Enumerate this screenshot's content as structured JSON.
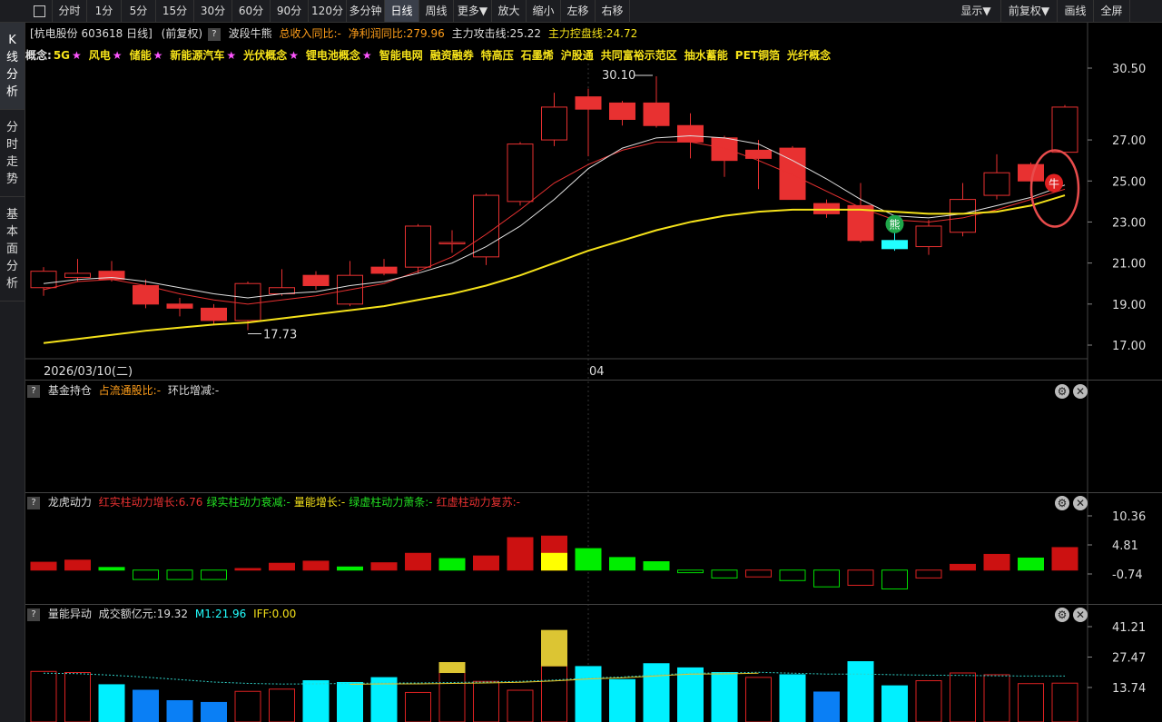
{
  "toolbar": {
    "left": [
      "分时",
      "1分",
      "5分",
      "15分",
      "30分",
      "60分",
      "90分",
      "120分",
      "多分钟",
      "日线",
      "周线",
      "更多▼",
      "放大",
      "缩小",
      "左移",
      "右移"
    ],
    "active": "日线",
    "right": [
      "显示▼",
      "前复权▼",
      "画线",
      "全屏"
    ]
  },
  "sidebar": [
    {
      "label": "K线分析",
      "active": true
    },
    {
      "label": "分时走势",
      "active": false
    },
    {
      "label": "基本面分析",
      "active": false
    }
  ],
  "header": {
    "stock": "[杭电股份 603618 日线]",
    "fq": "(前复权)",
    "indicator": "波段牛熊",
    "revenue_yoy": "总收入同比:-",
    "profit_yoy": "净利润同比:279.96",
    "attack": "主力攻击线:25.22",
    "control": "主力控盘线:24.72"
  },
  "concepts": {
    "label": "概念:",
    "items": [
      {
        "text": "5G",
        "star": true
      },
      {
        "text": "风电",
        "star": true
      },
      {
        "text": "储能",
        "star": true
      },
      {
        "text": "新能源汽车",
        "star": true
      },
      {
        "text": "光伏概念",
        "star": true
      },
      {
        "text": "锂电池概念",
        "star": true
      },
      {
        "text": "智能电网",
        "star": false
      },
      {
        "text": "融资融券",
        "star": false
      },
      {
        "text": "特高压",
        "star": false
      },
      {
        "text": "石墨烯",
        "star": false
      },
      {
        "text": "沪股通",
        "star": false
      },
      {
        "text": "共同富裕示范区",
        "star": false
      },
      {
        "text": "抽水蓄能",
        "star": false
      },
      {
        "text": "PET铜箔",
        "star": false
      },
      {
        "text": "光纤概念",
        "star": false
      }
    ]
  },
  "main_chart": {
    "y_ticks": [
      "30.50",
      "27.00",
      "25.00",
      "23.00",
      "21.00",
      "19.00",
      "17.00"
    ],
    "date_label": "2026/03/10(二)",
    "month_label": "04",
    "high_label": "30.10",
    "low_label": "17.73",
    "bear_badge": "熊",
    "bull_badge": "牛"
  },
  "fund_panel": {
    "title": "基金持仓",
    "ratio": "占流通股比:-",
    "change": "环比增减:-"
  },
  "dragon_panel": {
    "title": "龙虎动力",
    "items": [
      {
        "text": "红实柱动力增长:6.76",
        "color": "#e83131"
      },
      {
        "text": "绿实柱动力衰减:-",
        "color": "#22dd22"
      },
      {
        "text": "量能增长:-",
        "color": "#f5e21a"
      },
      {
        "text": "绿虚柱动力萧条:-",
        "color": "#22dd22"
      },
      {
        "text": "红虚柱动力复苏:-",
        "color": "#e83131"
      }
    ],
    "y_ticks": [
      "10.36",
      "4.81",
      "-0.74"
    ]
  },
  "volume_panel": {
    "title": "量能异动",
    "amount": "成交额亿元:19.32",
    "m1": "M1:21.96",
    "iff": "IFF:0.00",
    "y_ticks": [
      "41.21",
      "27.47",
      "13.74"
    ]
  },
  "colors": {
    "up": "#e83131",
    "down": "#22ffff",
    "ma_yellow": "#f5e21a",
    "ma_white": "#e0e0e0",
    "ma_red": "#e83131"
  },
  "chart_data": [
    {
      "type": "candlestick",
      "title": "杭电股份 603618 日线",
      "ylim": [
        17.0,
        30.5
      ],
      "candles": [
        {
          "o": 19.8,
          "c": 20.6,
          "h": 20.8,
          "l": 19.4
        },
        {
          "o": 20.3,
          "c": 20.5,
          "h": 21.2,
          "l": 20.1
        },
        {
          "o": 20.6,
          "c": 20.2,
          "h": 21.1,
          "l": 20.1
        },
        {
          "o": 19.9,
          "c": 19.0,
          "h": 20.2,
          "l": 18.8
        },
        {
          "o": 19.0,
          "c": 18.8,
          "h": 19.3,
          "l": 18.4
        },
        {
          "o": 18.8,
          "c": 18.2,
          "h": 19.0,
          "l": 18.0
        },
        {
          "o": 18.2,
          "c": 20.0,
          "h": 20.1,
          "l": 17.73
        },
        {
          "o": 19.5,
          "c": 19.8,
          "h": 20.7,
          "l": 19.4
        },
        {
          "o": 20.4,
          "c": 19.9,
          "h": 20.6,
          "l": 19.7
        },
        {
          "o": 19.0,
          "c": 20.4,
          "h": 21.1,
          "l": 18.9
        },
        {
          "o": 20.8,
          "c": 20.5,
          "h": 21.2,
          "l": 20.4
        },
        {
          "o": 20.8,
          "c": 22.8,
          "h": 22.9,
          "l": 20.5
        },
        {
          "o": 22.0,
          "c": 22.0,
          "h": 22.6,
          "l": 21.5
        },
        {
          "o": 21.3,
          "c": 24.3,
          "h": 24.4,
          "l": 20.9
        },
        {
          "o": 24.0,
          "c": 26.8,
          "h": 26.9,
          "l": 23.8
        },
        {
          "o": 27.0,
          "c": 28.6,
          "h": 29.3,
          "l": 26.7
        },
        {
          "o": 29.1,
          "c": 28.5,
          "h": 29.5,
          "l": 26.2
        },
        {
          "o": 28.8,
          "c": 28.0,
          "h": 28.9,
          "l": 27.7
        },
        {
          "o": 28.8,
          "c": 27.7,
          "h": 30.1,
          "l": 27.6
        },
        {
          "o": 27.7,
          "c": 26.9,
          "h": 28.3,
          "l": 26.1
        },
        {
          "o": 27.1,
          "c": 26.0,
          "h": 27.2,
          "l": 25.2
        },
        {
          "o": 26.5,
          "c": 26.1,
          "h": 27.0,
          "l": 24.6
        },
        {
          "o": 26.6,
          "c": 24.1,
          "h": 26.7,
          "l": 24.1
        },
        {
          "o": 23.9,
          "c": 23.4,
          "h": 24.1,
          "l": 23.2
        },
        {
          "o": 23.8,
          "c": 22.1,
          "h": 24.9,
          "l": 22.0
        },
        {
          "o": 22.1,
          "c": 21.7,
          "h": 22.6,
          "l": 21.6
        },
        {
          "o": 21.8,
          "c": 22.8,
          "h": 23.1,
          "l": 21.4
        },
        {
          "o": 22.5,
          "c": 24.1,
          "h": 24.9,
          "l": 22.3
        },
        {
          "o": 24.3,
          "c": 25.4,
          "h": 26.3,
          "l": 24.1
        },
        {
          "o": 25.8,
          "c": 25.0,
          "h": 25.9,
          "l": 24.3
        },
        {
          "o": 26.4,
          "c": 28.6,
          "h": 28.7,
          "l": 26.3
        }
      ],
      "ma_yellow": [
        17.1,
        17.3,
        17.5,
        17.7,
        17.85,
        18.0,
        18.1,
        18.3,
        18.5,
        18.7,
        18.9,
        19.2,
        19.5,
        19.9,
        20.4,
        21.0,
        21.6,
        22.1,
        22.6,
        23.0,
        23.3,
        23.5,
        23.6,
        23.6,
        23.6,
        23.5,
        23.4,
        23.4,
        23.5,
        23.8,
        24.3
      ],
      "ma_white": [
        20.0,
        20.2,
        20.3,
        20.1,
        19.8,
        19.5,
        19.3,
        19.5,
        19.6,
        19.9,
        20.1,
        20.5,
        21.0,
        21.8,
        22.8,
        24.1,
        25.6,
        26.6,
        27.1,
        27.2,
        27.1,
        26.8,
        26.0,
        25.1,
        24.1,
        23.3,
        23.2,
        23.4,
        23.8,
        24.2,
        24.8
      ],
      "ma_red": [
        19.7,
        20.1,
        20.2,
        19.9,
        19.5,
        19.2,
        19.0,
        19.2,
        19.4,
        19.7,
        20.0,
        20.6,
        21.3,
        22.4,
        23.6,
        24.9,
        25.8,
        26.5,
        26.9,
        26.9,
        26.6,
        26.0,
        25.3,
        24.5,
        23.7,
        23.1,
        23.0,
        23.2,
        23.6,
        24.1,
        24.6
      ]
    },
    {
      "type": "bar",
      "title": "龙虎动力",
      "ylim": [
        -4.0,
        11.5
      ],
      "values": [
        {
          "v": 1.5,
          "k": "red_solid"
        },
        {
          "v": 1.9,
          "k": "red_solid"
        },
        {
          "v": 0.5,
          "k": "green_solid"
        },
        {
          "v": -1.8,
          "k": "green_hollow"
        },
        {
          "v": -1.8,
          "k": "green_hollow"
        },
        {
          "v": -1.8,
          "k": "green_hollow"
        },
        {
          "v": 0.3,
          "k": "red_solid"
        },
        {
          "v": 1.3,
          "k": "red_solid"
        },
        {
          "v": 1.7,
          "k": "red_solid"
        },
        {
          "v": 0.6,
          "k": "green_solid"
        },
        {
          "v": 1.4,
          "k": "red_solid"
        },
        {
          "v": 3.2,
          "k": "red_solid"
        },
        {
          "v": 2.2,
          "k": "green_solid"
        },
        {
          "v": 2.7,
          "k": "red_solid"
        },
        {
          "v": 6.2,
          "k": "red_solid"
        },
        {
          "v": 6.5,
          "k": "red_yellow",
          "y": 3.2
        },
        {
          "v": 4.1,
          "k": "green_solid"
        },
        {
          "v": 2.4,
          "k": "green_solid"
        },
        {
          "v": 1.6,
          "k": "green_solid"
        },
        {
          "v": -0.5,
          "k": "green_hollow"
        },
        {
          "v": -1.5,
          "k": "green_hollow"
        },
        {
          "v": -1.3,
          "k": "red_hollow"
        },
        {
          "v": -2.0,
          "k": "green_hollow"
        },
        {
          "v": -3.2,
          "k": "green_hollow"
        },
        {
          "v": -2.9,
          "k": "red_hollow"
        },
        {
          "v": -3.6,
          "k": "green_hollow"
        },
        {
          "v": -1.5,
          "k": "red_hollow"
        },
        {
          "v": 1.1,
          "k": "red_solid"
        },
        {
          "v": 3.0,
          "k": "red_solid"
        },
        {
          "v": 2.3,
          "k": "green_solid"
        },
        {
          "v": 4.3,
          "k": "red_solid"
        }
      ]
    },
    {
      "type": "bar",
      "title": "量能异动",
      "ylim": [
        0,
        43
      ],
      "values": [
        {
          "v": 21.0,
          "k": "red_hollow"
        },
        {
          "v": 20.5,
          "k": "red_hollow"
        },
        {
          "v": 15.0,
          "k": "cyan"
        },
        {
          "v": 12.5,
          "k": "blue"
        },
        {
          "v": 7.8,
          "k": "blue"
        },
        {
          "v": 7.0,
          "k": "blue"
        },
        {
          "v": 12.0,
          "k": "red_hollow"
        },
        {
          "v": 13.0,
          "k": "red_hollow"
        },
        {
          "v": 16.8,
          "k": "cyan"
        },
        {
          "v": 16.0,
          "k": "cyan"
        },
        {
          "v": 18.2,
          "k": "cyan"
        },
        {
          "v": 11.5,
          "k": "red_hollow"
        },
        {
          "v": 20.5,
          "k": "red_hollow",
          "y": 4.5
        },
        {
          "v": 16.5,
          "k": "red_hollow"
        },
        {
          "v": 12.5,
          "k": "red_hollow"
        },
        {
          "v": 23.5,
          "k": "red_hollow",
          "y": 16.0
        },
        {
          "v": 23.2,
          "k": "cyan"
        },
        {
          "v": 17.3,
          "k": "cyan"
        },
        {
          "v": 24.5,
          "k": "cyan"
        },
        {
          "v": 22.6,
          "k": "cyan"
        },
        {
          "v": 20.5,
          "k": "cyan"
        },
        {
          "v": 18.3,
          "k": "red_hollow"
        },
        {
          "v": 19.5,
          "k": "cyan"
        },
        {
          "v": 11.7,
          "k": "blue"
        },
        {
          "v": 25.4,
          "k": "cyan"
        },
        {
          "v": 14.5,
          "k": "cyan"
        },
        {
          "v": 16.8,
          "k": "red_hollow"
        },
        {
          "v": 20.3,
          "k": "red_hollow"
        },
        {
          "v": 19.5,
          "k": "red_hollow"
        },
        {
          "v": 15.5,
          "k": "red_hollow"
        },
        {
          "v": 15.7,
          "k": "red_hollow"
        }
      ],
      "m1": [
        20.2,
        20.0,
        19.3,
        18.4,
        17.3,
        16.2,
        15.6,
        15.3,
        15.4,
        15.6,
        15.8,
        15.8,
        16.0,
        16.2,
        16.5,
        17.1,
        18.0,
        18.5,
        19.4,
        20.2,
        20.3,
        20.6,
        20.2,
        19.8,
        19.8,
        19.5,
        19.3,
        19.2,
        19.0,
        18.9,
        18.9
      ]
    }
  ]
}
